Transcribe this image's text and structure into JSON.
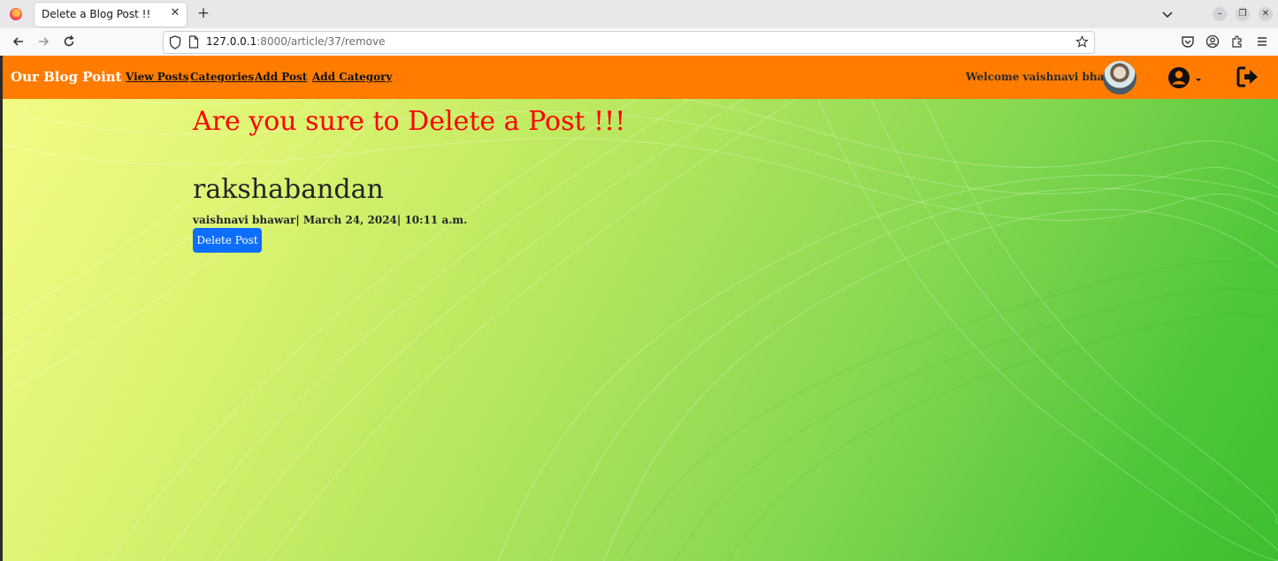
{
  "browser": {
    "tab_title": "Delete a Blog Post !!",
    "url_host": "127.0.0.1",
    "url_path": ":8000/article/37/remove",
    "icons": [
      "firefox-logo",
      "close-icon",
      "plus-icon",
      "chevron-down-icon",
      "minimize-icon",
      "restore-icon",
      "close-window-icon",
      "back-icon",
      "forward-icon",
      "reload-icon",
      "shield-icon",
      "page-icon",
      "star-icon",
      "pocket-icon",
      "account-icon",
      "extensions-icon",
      "menu-icon"
    ]
  },
  "site": {
    "brand": "Our Blog Point",
    "nav": [
      {
        "label": "View Posts"
      },
      {
        "label": "Categories"
      },
      {
        "label": "Add Post"
      },
      {
        "label": "Add Category"
      }
    ],
    "welcome": "Welcome vaishnavi bhawar",
    "nav_color": "#ff7c00"
  },
  "page": {
    "confirm_heading": "Are you sure to Delete a Post !!!",
    "post_title": "rakshabandan",
    "post_meta": "vaishnavi bhawar| March 24, 2024| 10:11 a.m.",
    "delete_label": "Delete Post",
    "heading_color": "#ff0000",
    "button_color": "#0d6efd"
  }
}
